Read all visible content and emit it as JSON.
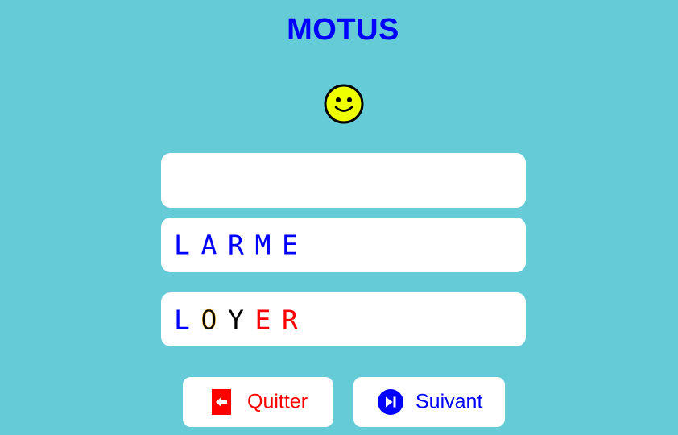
{
  "header": {
    "title": "MOTUS"
  },
  "status": {
    "icon": "smiley-face-icon",
    "face_color": "#f0ff00"
  },
  "input": {
    "value": "",
    "placeholder": ""
  },
  "attempts": [
    {
      "letters": [
        {
          "char": "L",
          "color": "#0000ff"
        },
        {
          "char": "A",
          "color": "#0000ff"
        },
        {
          "char": "R",
          "color": "#0000ff"
        },
        {
          "char": "M",
          "color": "#0000ff"
        },
        {
          "char": "E",
          "color": "#0000ff"
        }
      ]
    },
    {
      "letters": [
        {
          "char": "L",
          "color": "#0000ff"
        },
        {
          "char": "O",
          "color": "#000000",
          "outline": "#f5a300"
        },
        {
          "char": "Y",
          "color": "#000000"
        },
        {
          "char": "E",
          "color": "#ff0000"
        },
        {
          "char": "R",
          "color": "#ff0000"
        }
      ]
    }
  ],
  "buttons": {
    "quit": {
      "label": "Quitter",
      "icon": "exit-door-icon",
      "color": "#ff0000"
    },
    "next": {
      "label": "Suivant",
      "icon": "skip-next-icon",
      "color": "#0000ff"
    }
  }
}
